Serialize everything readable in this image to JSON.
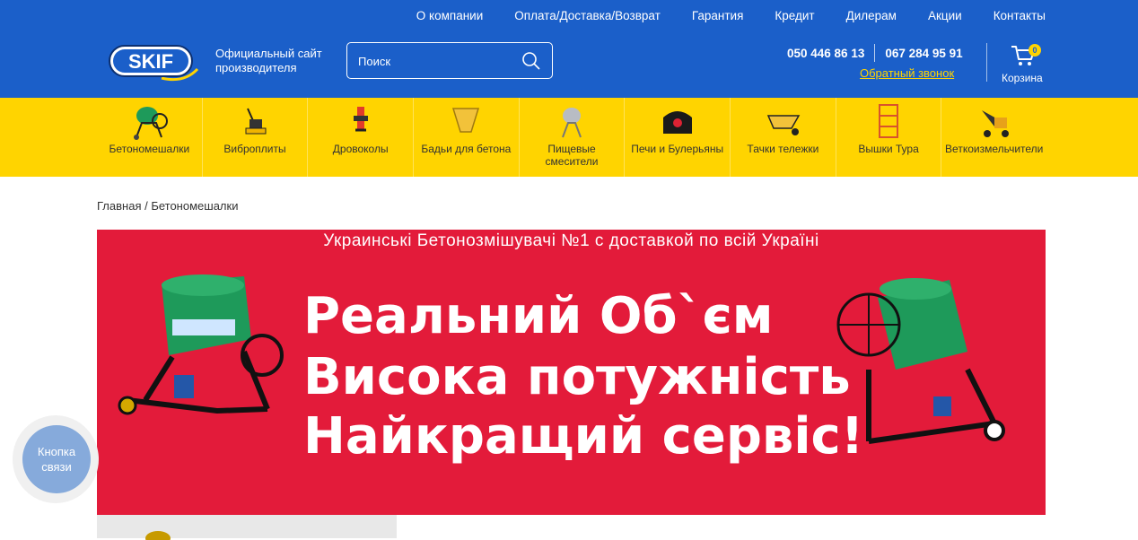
{
  "topnav": [
    "О компании",
    "Оплата/Доставка/Возврат",
    "Гарантия",
    "Кредит",
    "Дилерам",
    "Акции",
    "Контакты"
  ],
  "logo": {
    "text": "SKIF"
  },
  "tagline": "Официальный сайт производителя",
  "search": {
    "placeholder": "Поиск",
    "icon": "search-icon"
  },
  "phones": [
    "050 446 86 13",
    "067 284 95 91"
  ],
  "callback_label": "Обратный звонок",
  "cart": {
    "count": "0",
    "label": "Корзина",
    "icon": "cart-icon"
  },
  "categories": [
    {
      "label": "Бетономешалки",
      "icon": "concrete-mixer-icon"
    },
    {
      "label": "Виброплиты",
      "icon": "vibration-plate-icon"
    },
    {
      "label": "Дровоколы",
      "icon": "log-splitter-icon"
    },
    {
      "label": "Бадьи для бетона",
      "icon": "concrete-bucket-icon"
    },
    {
      "label": "Пищевые смесители",
      "icon": "food-mixer-icon"
    },
    {
      "label": "Печи и Булерьяны",
      "icon": "stove-icon"
    },
    {
      "label": "Тачки тележки",
      "icon": "wheelbarrow-icon"
    },
    {
      "label": "Вышки Тура",
      "icon": "scaffold-tower-icon"
    },
    {
      "label": "Веткоизмельчители",
      "icon": "wood-chipper-icon"
    }
  ],
  "breadcrumb": "Главная / Бетономешалки",
  "banner": {
    "subtitle": "Украинські Бетонозмішувачі  №1 с  доставкой по всій Україні",
    "lines": [
      "Реальний Об`єм",
      "Висока потужність",
      "Найкращий сервіс!"
    ]
  },
  "contact_button": "Кнопка связи",
  "colors": {
    "header_blue": "#1b5fc9",
    "yellow": "#ffd400",
    "banner_red": "#e31b3a",
    "mixer_green": "#1e9a5a"
  }
}
